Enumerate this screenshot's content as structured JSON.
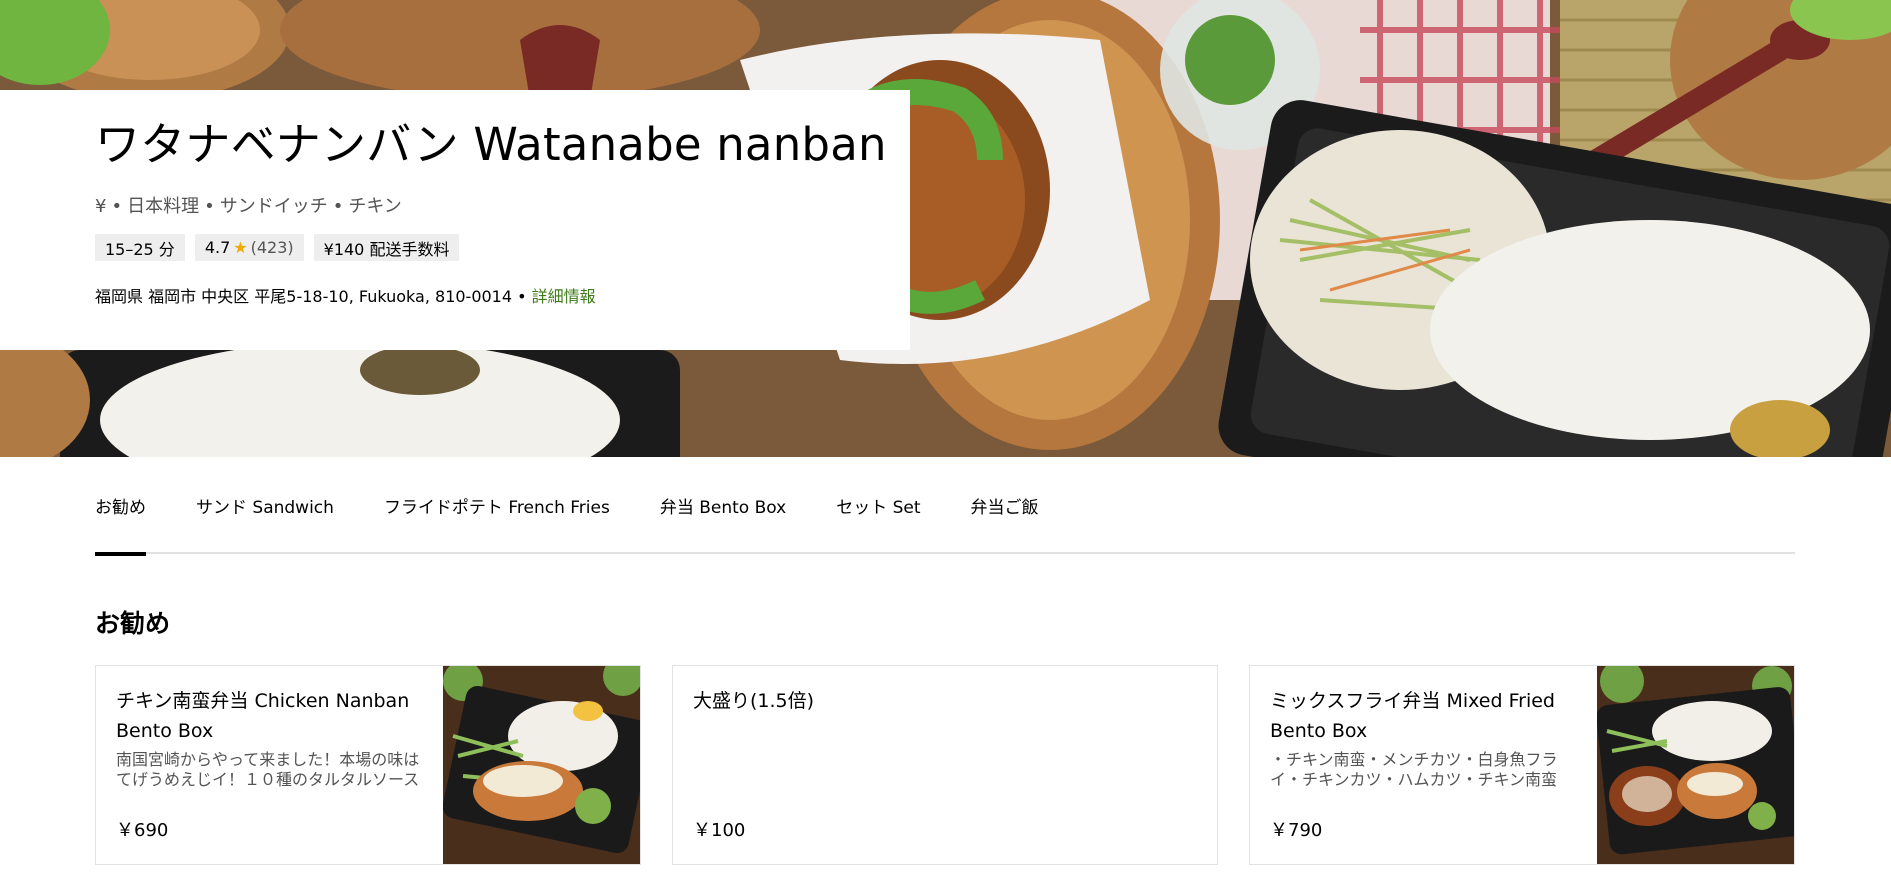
{
  "store": {
    "title": "ワタナベナンバン Watanabe nanban",
    "price_level": "¥",
    "categories": [
      "日本料理",
      "サンドイッチ",
      "チキン"
    ],
    "separator": "•",
    "delivery_time": "15–25 分",
    "rating": "4.7",
    "rating_count": "(423)",
    "delivery_fee": "¥140 配送手数料",
    "address": "福岡県 福岡市 中央区 平尾5-18-10, Fukuoka, 810-0014",
    "details_link": "詳細情報"
  },
  "tabs": [
    {
      "label": "お勧め",
      "active": true
    },
    {
      "label": "サンド Sandwich",
      "active": false
    },
    {
      "label": "フライドポテト French Fries",
      "active": false
    },
    {
      "label": "弁当 Bento Box",
      "active": false
    },
    {
      "label": "セット Set",
      "active": false
    },
    {
      "label": "弁当ご飯",
      "active": false
    }
  ],
  "section": {
    "title": "お勧め",
    "items": [
      {
        "name": "チキン南蛮弁当 Chicken Nanban Bento Box",
        "description": "南国宮崎からやって来ました！本場の味はてげうめえじイ！１０種のタルタルソース",
        "price": "￥690",
        "has_image": true
      },
      {
        "name": "大盛り(1.5倍)",
        "description": "",
        "price": "￥100",
        "has_image": false
      },
      {
        "name": "ミックスフライ弁当 Mixed Fried Bento Box",
        "description": "・チキン南蛮・メンチカツ・白身魚フライ・チキンカツ・ハムカツ・チキン南蛮",
        "price": "￥790",
        "has_image": true
      }
    ]
  },
  "colors": {
    "accent_link": "#3e7b1a",
    "star": "#f2a900",
    "pill_bg": "#eeeeee",
    "muted_text": "#545454"
  }
}
